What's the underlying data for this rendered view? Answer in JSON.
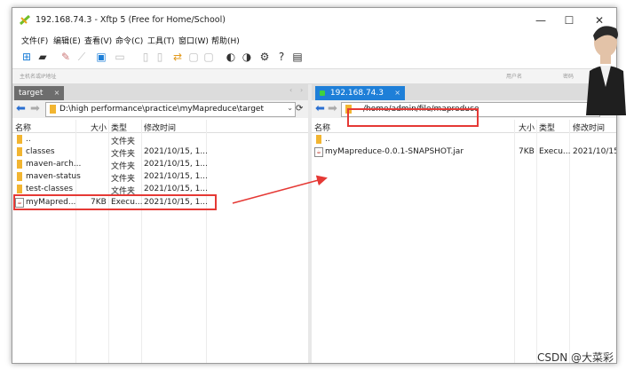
{
  "window": {
    "title": "192.168.74.3   - Xftp 5 (Free for Home/School)",
    "controls": {
      "minimize": "—",
      "maximize": "☐",
      "close": "✕"
    }
  },
  "menu": [
    {
      "label": "文件(F)"
    },
    {
      "label": "编辑(E)"
    },
    {
      "label": "查看(V)"
    },
    {
      "label": "命令(C)"
    },
    {
      "label": "工具(T)"
    },
    {
      "label": "窗口(W)"
    },
    {
      "label": "帮助(H)"
    }
  ],
  "address": {
    "host_hint": "主机名或IP地址",
    "user_hint": "用户名",
    "pass_hint": "密码"
  },
  "left_pane": {
    "tab": "target",
    "path": "D:\\high performance\\practice\\myMapreduce\\target",
    "headers": {
      "name": "名称",
      "size": "大小",
      "type": "类型",
      "modified": "修改时间"
    },
    "rows": [
      {
        "name": "..",
        "size": "",
        "type": "文件夹",
        "modified": "",
        "icon": "folder"
      },
      {
        "name": "classes",
        "size": "",
        "type": "文件夹",
        "modified": "2021/10/15, 1...",
        "icon": "folder"
      },
      {
        "name": "maven-arch...",
        "size": "",
        "type": "文件夹",
        "modified": "2021/10/15, 1...",
        "icon": "folder"
      },
      {
        "name": "maven-status",
        "size": "",
        "type": "文件夹",
        "modified": "2021/10/15, 1...",
        "icon": "folder"
      },
      {
        "name": "test-classes",
        "size": "",
        "type": "文件夹",
        "modified": "2021/10/15, 1...",
        "icon": "folder"
      },
      {
        "name": "myMapred...",
        "size": "7KB",
        "type": "Execu...",
        "modified": "2021/10/15, 1...",
        "icon": "jar"
      }
    ]
  },
  "right_pane": {
    "tab": "192.168.74.3",
    "path": "/home/admin/file/mapreduce",
    "headers": {
      "name": "名称",
      "size": "大小",
      "type": "类型",
      "modified": "修改时间"
    },
    "rows": [
      {
        "name": "..",
        "size": "",
        "type": "",
        "modified": "",
        "icon": "folder"
      },
      {
        "name": "myMapreduce-0.0.1-SNAPSHOT.jar",
        "size": "7KB",
        "type": "Execu...",
        "modified": "2021/10/15",
        "icon": "jar"
      }
    ]
  },
  "watermark": "CSDN @大菜彩",
  "colors": {
    "tab_active": "#1e7fd8",
    "tab_inactive": "#6d6d6d",
    "highlight": "#e53935",
    "folder": "#f2b531"
  }
}
